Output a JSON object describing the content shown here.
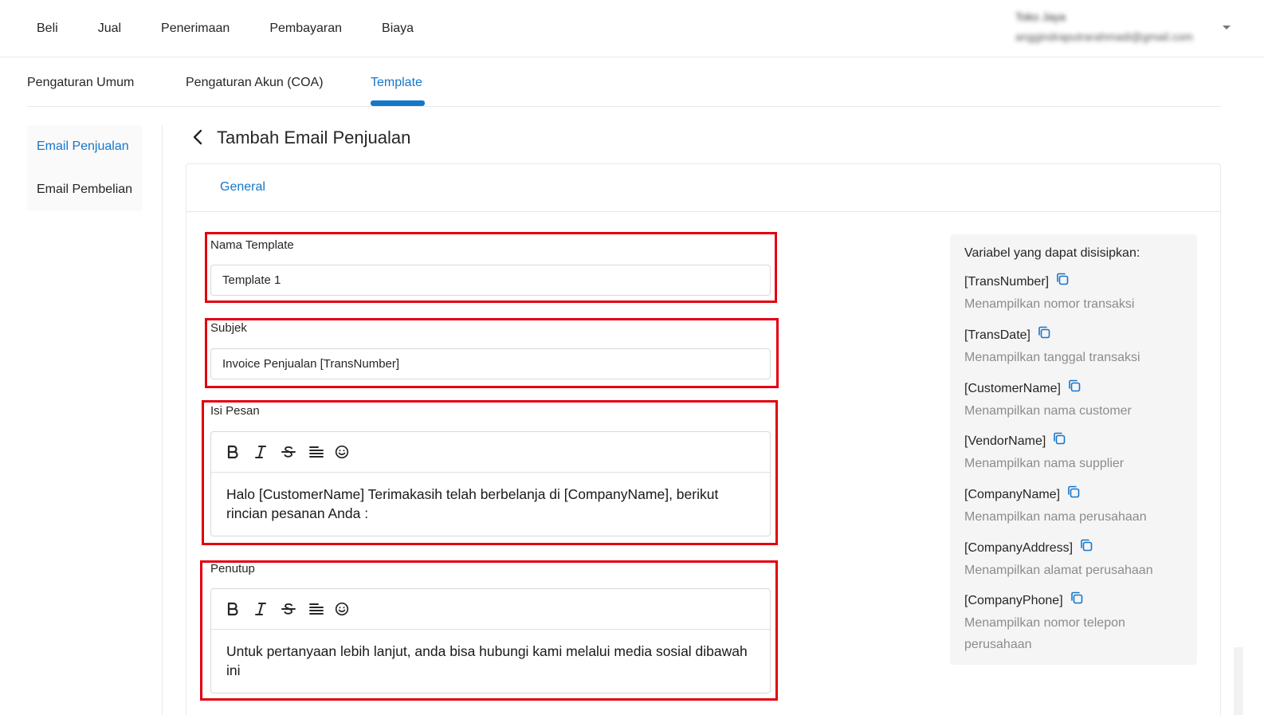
{
  "topnav": {
    "items": [
      "Beli",
      "Jual",
      "Penerimaan",
      "Pembayaran",
      "Biaya"
    ]
  },
  "user": {
    "name": "Toko Jaya",
    "email": "anggindraputrarahmadi@gmail.com"
  },
  "settings_tabs": {
    "general": "Pengaturan Umum",
    "coa": "Pengaturan Akun (COA)",
    "template": "Template"
  },
  "sidebar": {
    "items": [
      "Email Penjualan",
      "Email Pembelian"
    ]
  },
  "page": {
    "title": "Tambah Email Penjualan"
  },
  "card": {
    "tab": "General"
  },
  "form": {
    "name": {
      "label": "Nama Template",
      "value": "Template 1"
    },
    "subject": {
      "label": "Subjek",
      "value": "Invoice Penjualan [TransNumber]"
    },
    "body": {
      "label": "Isi Pesan",
      "content": "Halo [CustomerName] Terimakasih telah berbelanja di [CompanyName], berikut rincian pesanan Anda :"
    },
    "closing": {
      "label": "Penutup",
      "content": "Untuk pertanyaan lebih lanjut, anda bisa hubungi kami melalui media sosial dibawah ini"
    }
  },
  "variables": {
    "title": "Variabel yang dapat disisipkan:",
    "items": [
      {
        "name": "[TransNumber]",
        "desc": "Menampilkan nomor transaksi"
      },
      {
        "name": "[TransDate]",
        "desc": "Menampilkan tanggal transaksi"
      },
      {
        "name": "[CustomerName]",
        "desc": "Menampilkan nama customer"
      },
      {
        "name": "[VendorName]",
        "desc": "Menampilkan nama supplier"
      },
      {
        "name": "[CompanyName]",
        "desc": "Menampilkan nama perusahaan"
      },
      {
        "name": "[CompanyAddress]",
        "desc": "Menampilkan alamat perusahaan"
      },
      {
        "name": "[CompanyPhone]",
        "desc": "Menampilkan nomor telepon perusahaan"
      }
    ]
  },
  "colors": {
    "accent": "#1677c9",
    "highlight": "#e3000f",
    "muted": "#8c8c8c"
  },
  "icons": {
    "back": "chevron-left-icon",
    "copy": "copy-icon",
    "bold": "bold-icon",
    "italic": "italic-icon",
    "strike": "strikethrough-icon",
    "align": "align-icon",
    "emoji": "emoji-icon"
  }
}
